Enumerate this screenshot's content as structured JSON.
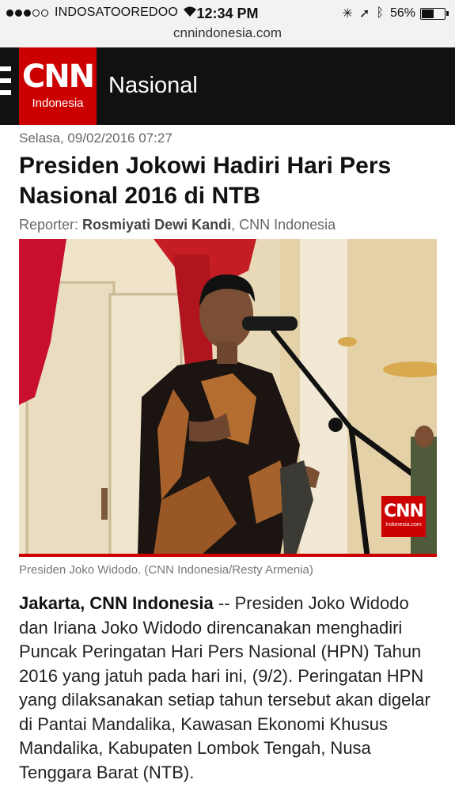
{
  "status_bar": {
    "carrier": "INDOSATOOREDOO",
    "time": "12:34 PM",
    "battery": "56%",
    "battery_level": 0.56,
    "signal_bars": 3,
    "signal_max": 5
  },
  "browser": {
    "url": "cnnindonesia.com"
  },
  "header": {
    "logo_main": "CNN",
    "logo_sub": "Indonesia",
    "section": "Nasional"
  },
  "article": {
    "date": "Selasa, 09/02/2016 07:27",
    "title": "Presiden Jokowi Hadiri Hari Pers Nasional 2016 di NTB",
    "reporter_label": "Reporter: ",
    "reporter_name": "Rosmiyati Dewi Kandi",
    "reporter_org": ", CNN Indonesia",
    "photo_watermark_main": "CNN",
    "photo_watermark_sub": "Indonesia.com",
    "caption": "Presiden Joko Widodo. (CNN Indonesia/Resty Armenia)",
    "lead_bold": "Jakarta, CNN Indonesia",
    "lead_text": " -- Presiden Joko Widodo dan Iriana Joko Widodo direncanakan menghadiri Puncak Peringatan Hari Pers Nasional (HPN) Tahun 2016 yang jatuh pada hari ini, (9/2). Peringatan HPN yang dilaksanakan setiap tahun tersebut akan digelar di Pantai Mandalika, Kawasan Ekonomi Khusus Mandalika, Kabupaten Lombok Tengah, Nusa Tenggara Barat (NTB)."
  },
  "colors": {
    "brand_red": "#cc0000",
    "nav_bg": "#111111"
  }
}
